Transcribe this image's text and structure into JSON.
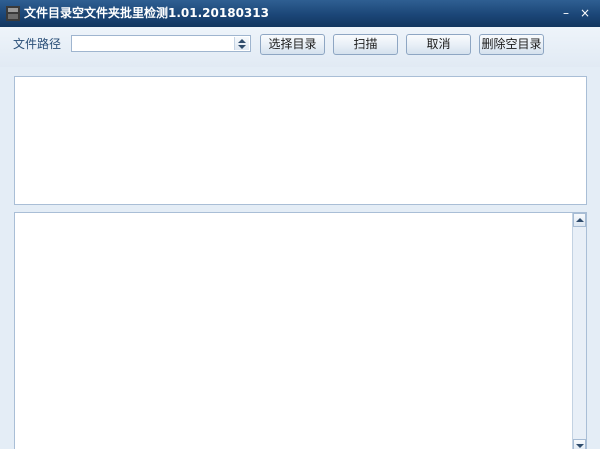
{
  "window": {
    "title": "文件目录空文件夹批里检测1.01.20180313",
    "minimize_glyph": "–",
    "close_glyph": "×"
  },
  "toolbar": {
    "path_label": "文件路径",
    "path_value": "",
    "select_dir_label": "选择目录",
    "scan_label": "扫描",
    "cancel_label": "取消",
    "delete_empty_label": "删除空目录"
  },
  "icons": {
    "app": "app-icon",
    "minimize": "minimize-icon",
    "close": "close-icon",
    "spin_up": "spin-up-icon",
    "spin_down": "spin-down-icon",
    "scroll_up": "scroll-up-icon",
    "scroll_down": "scroll-down-icon"
  },
  "colors": {
    "titlebar": "#1b4677",
    "window_bg": "#e4edf6",
    "panel_border": "#a9bed6",
    "label_text": "#2a4f78"
  }
}
